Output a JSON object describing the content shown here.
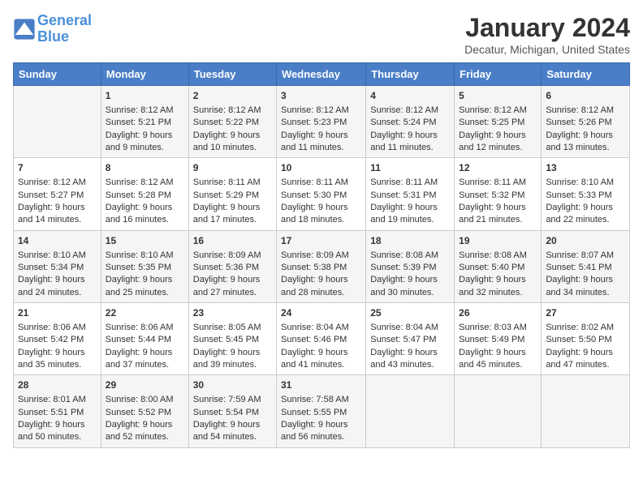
{
  "header": {
    "logo_line1": "General",
    "logo_line2": "Blue",
    "title": "January 2024",
    "subtitle": "Decatur, Michigan, United States"
  },
  "days_of_week": [
    "Sunday",
    "Monday",
    "Tuesday",
    "Wednesday",
    "Thursday",
    "Friday",
    "Saturday"
  ],
  "weeks": [
    [
      {
        "day": "",
        "content": ""
      },
      {
        "day": "1",
        "content": "Sunrise: 8:12 AM\nSunset: 5:21 PM\nDaylight: 9 hours\nand 9 minutes."
      },
      {
        "day": "2",
        "content": "Sunrise: 8:12 AM\nSunset: 5:22 PM\nDaylight: 9 hours\nand 10 minutes."
      },
      {
        "day": "3",
        "content": "Sunrise: 8:12 AM\nSunset: 5:23 PM\nDaylight: 9 hours\nand 11 minutes."
      },
      {
        "day": "4",
        "content": "Sunrise: 8:12 AM\nSunset: 5:24 PM\nDaylight: 9 hours\nand 11 minutes."
      },
      {
        "day": "5",
        "content": "Sunrise: 8:12 AM\nSunset: 5:25 PM\nDaylight: 9 hours\nand 12 minutes."
      },
      {
        "day": "6",
        "content": "Sunrise: 8:12 AM\nSunset: 5:26 PM\nDaylight: 9 hours\nand 13 minutes."
      }
    ],
    [
      {
        "day": "7",
        "content": "Sunrise: 8:12 AM\nSunset: 5:27 PM\nDaylight: 9 hours\nand 14 minutes."
      },
      {
        "day": "8",
        "content": "Sunrise: 8:12 AM\nSunset: 5:28 PM\nDaylight: 9 hours\nand 16 minutes."
      },
      {
        "day": "9",
        "content": "Sunrise: 8:11 AM\nSunset: 5:29 PM\nDaylight: 9 hours\nand 17 minutes."
      },
      {
        "day": "10",
        "content": "Sunrise: 8:11 AM\nSunset: 5:30 PM\nDaylight: 9 hours\nand 18 minutes."
      },
      {
        "day": "11",
        "content": "Sunrise: 8:11 AM\nSunset: 5:31 PM\nDaylight: 9 hours\nand 19 minutes."
      },
      {
        "day": "12",
        "content": "Sunrise: 8:11 AM\nSunset: 5:32 PM\nDaylight: 9 hours\nand 21 minutes."
      },
      {
        "day": "13",
        "content": "Sunrise: 8:10 AM\nSunset: 5:33 PM\nDaylight: 9 hours\nand 22 minutes."
      }
    ],
    [
      {
        "day": "14",
        "content": "Sunrise: 8:10 AM\nSunset: 5:34 PM\nDaylight: 9 hours\nand 24 minutes."
      },
      {
        "day": "15",
        "content": "Sunrise: 8:10 AM\nSunset: 5:35 PM\nDaylight: 9 hours\nand 25 minutes."
      },
      {
        "day": "16",
        "content": "Sunrise: 8:09 AM\nSunset: 5:36 PM\nDaylight: 9 hours\nand 27 minutes."
      },
      {
        "day": "17",
        "content": "Sunrise: 8:09 AM\nSunset: 5:38 PM\nDaylight: 9 hours\nand 28 minutes."
      },
      {
        "day": "18",
        "content": "Sunrise: 8:08 AM\nSunset: 5:39 PM\nDaylight: 9 hours\nand 30 minutes."
      },
      {
        "day": "19",
        "content": "Sunrise: 8:08 AM\nSunset: 5:40 PM\nDaylight: 9 hours\nand 32 minutes."
      },
      {
        "day": "20",
        "content": "Sunrise: 8:07 AM\nSunset: 5:41 PM\nDaylight: 9 hours\nand 34 minutes."
      }
    ],
    [
      {
        "day": "21",
        "content": "Sunrise: 8:06 AM\nSunset: 5:42 PM\nDaylight: 9 hours\nand 35 minutes."
      },
      {
        "day": "22",
        "content": "Sunrise: 8:06 AM\nSunset: 5:44 PM\nDaylight: 9 hours\nand 37 minutes."
      },
      {
        "day": "23",
        "content": "Sunrise: 8:05 AM\nSunset: 5:45 PM\nDaylight: 9 hours\nand 39 minutes."
      },
      {
        "day": "24",
        "content": "Sunrise: 8:04 AM\nSunset: 5:46 PM\nDaylight: 9 hours\nand 41 minutes."
      },
      {
        "day": "25",
        "content": "Sunrise: 8:04 AM\nSunset: 5:47 PM\nDaylight: 9 hours\nand 43 minutes."
      },
      {
        "day": "26",
        "content": "Sunrise: 8:03 AM\nSunset: 5:49 PM\nDaylight: 9 hours\nand 45 minutes."
      },
      {
        "day": "27",
        "content": "Sunrise: 8:02 AM\nSunset: 5:50 PM\nDaylight: 9 hours\nand 47 minutes."
      }
    ],
    [
      {
        "day": "28",
        "content": "Sunrise: 8:01 AM\nSunset: 5:51 PM\nDaylight: 9 hours\nand 50 minutes."
      },
      {
        "day": "29",
        "content": "Sunrise: 8:00 AM\nSunset: 5:52 PM\nDaylight: 9 hours\nand 52 minutes."
      },
      {
        "day": "30",
        "content": "Sunrise: 7:59 AM\nSunset: 5:54 PM\nDaylight: 9 hours\nand 54 minutes."
      },
      {
        "day": "31",
        "content": "Sunrise: 7:58 AM\nSunset: 5:55 PM\nDaylight: 9 hours\nand 56 minutes."
      },
      {
        "day": "",
        "content": ""
      },
      {
        "day": "",
        "content": ""
      },
      {
        "day": "",
        "content": ""
      }
    ]
  ]
}
